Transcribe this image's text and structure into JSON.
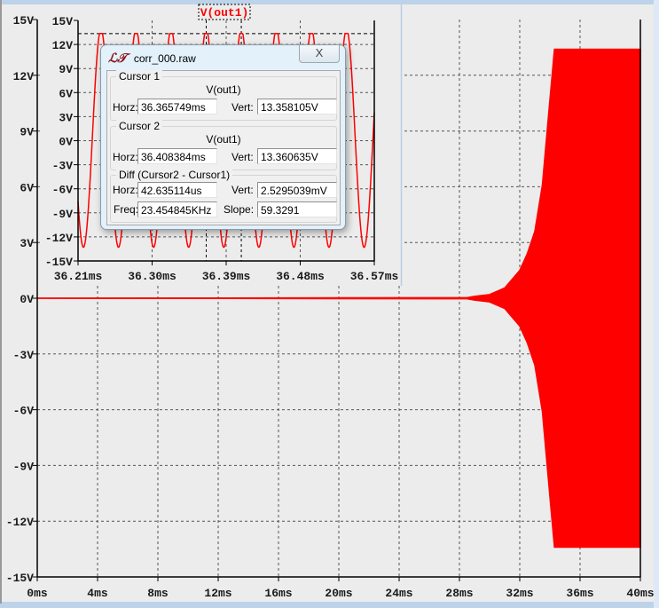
{
  "chart_data": [
    {
      "type": "line",
      "title": "",
      "xlabel": "",
      "ylabel": "",
      "x_ticks": [
        "0ms",
        "4ms",
        "8ms",
        "12ms",
        "16ms",
        "20ms",
        "24ms",
        "28ms",
        "32ms",
        "36ms",
        "40ms"
      ],
      "y_ticks": [
        "15V",
        "12V",
        "9V",
        "6V",
        "3V",
        "0V",
        "-3V",
        "-6V",
        "-9V",
        "-12V",
        "-15V"
      ],
      "xlim_ms": [
        0,
        40
      ],
      "ylim_v": [
        -15,
        15
      ],
      "grid": true,
      "series": [
        {
          "color": "#ff0000",
          "envelope_ms_v": [
            [
              0,
              0
            ],
            [
              28.5,
              0.03
            ],
            [
              29,
              0.1
            ],
            [
              30,
              0.2
            ],
            [
              31,
              0.55
            ],
            [
              32,
              1.5
            ],
            [
              32.5,
              2.4
            ],
            [
              33,
              3.6
            ],
            [
              33.5,
              6.1
            ],
            [
              34,
              10.7
            ],
            [
              34.3,
              13.4
            ],
            [
              40,
              13.4
            ]
          ]
        }
      ]
    },
    {
      "type": "line",
      "title": "V(out1)",
      "x_ticks": [
        "36.21ms",
        "36.30ms",
        "36.39ms",
        "36.48ms",
        "36.57ms"
      ],
      "y_ticks": [
        "15V",
        "12V",
        "9V",
        "6V",
        "3V",
        "0V",
        "-3V",
        "-6V",
        "-9V",
        "-12V",
        "-15V"
      ],
      "xlim_ms": [
        36.21,
        36.57
      ],
      "ylim_v": [
        -15,
        15
      ],
      "grid": true,
      "series": [
        {
          "name": "V(out1)",
          "color": "#ff0000",
          "peak_v": 13.36,
          "trough_v": -13.3,
          "period_ms": 0.042635114,
          "peak_time_ms": 36.365749
        }
      ],
      "cursors_ms": [
        36.365749,
        36.408384
      ],
      "cursor_level_v": 13.36
    }
  ],
  "dialog": {
    "title": "corr_000.raw",
    "logo": "LT",
    "close_label": "X",
    "cursor1": {
      "legend": "Cursor 1",
      "signal": "V(out1)",
      "horz_label": "Horz:",
      "horz": "36.365749ms",
      "vert_label": "Vert:",
      "vert": "13.358105V"
    },
    "cursor2": {
      "legend": "Cursor 2",
      "signal": "V(out1)",
      "horz_label": "Horz:",
      "horz": "36.408384ms",
      "vert_label": "Vert:",
      "vert": "13.360635V"
    },
    "diff": {
      "legend": "Diff (Cursor2 - Cursor1)",
      "horz_label": "Horz:",
      "horz": "42.635114us",
      "vert_label": "Vert:",
      "vert": "2.5295039mV",
      "freq_label": "Freq:",
      "freq": "23.454845KHz",
      "slope_label": "Slope:",
      "slope": "59.3291"
    }
  }
}
